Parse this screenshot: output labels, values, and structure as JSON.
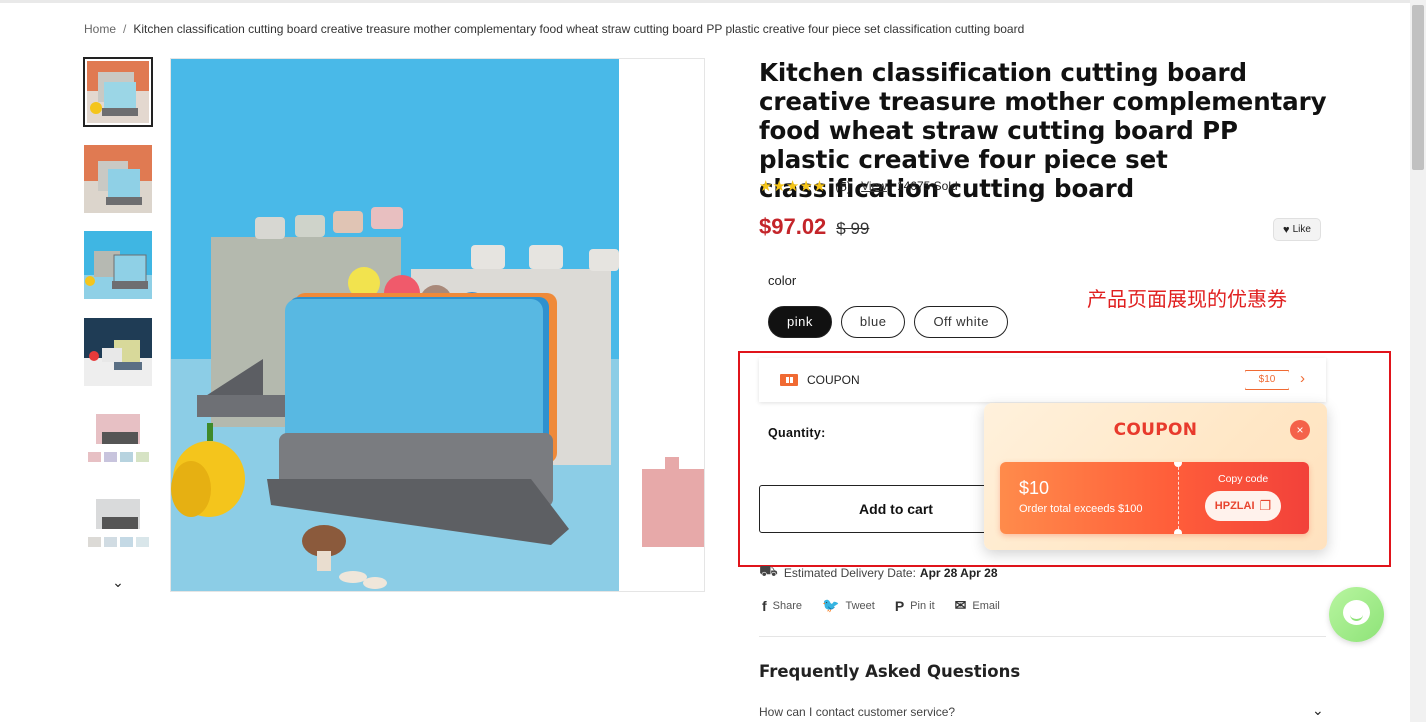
{
  "breadcrumb": {
    "home": "Home",
    "separator": "/",
    "current": "Kitchen classification cutting board creative treasure mother complementary food wheat straw cutting board PP plastic creative four piece set classification cutting board"
  },
  "product": {
    "title": "Kitchen classification cutting board creative treasure mother complementary food wheat straw cutting board PP plastic creative four piece set classification cutting board",
    "stars": "★★★★★",
    "review_count": "(5)",
    "view_label": "View",
    "sold": "14675 Sold",
    "price": "$97.02",
    "compare_price": "$ 99",
    "like_label": "Like",
    "color_label": "color",
    "colors": [
      "pink",
      "blue",
      "Off white"
    ],
    "selected_color": "pink",
    "quantity_label": "Quantity:",
    "add_to_cart": "Add to cart",
    "delivery_label": "Estimated Delivery Date:",
    "delivery_dates": "Apr 28 Apr 28"
  },
  "annotation": "产品页面展现的优惠券",
  "coupon_row": {
    "label": "COUPON",
    "tag": "$10",
    "chevron": "›"
  },
  "coupon_popup": {
    "title": "COUPON",
    "close": "×",
    "amount": "$10",
    "condition": "Order total exceeds $100",
    "copy_label": "Copy code",
    "code": "HPZLAI"
  },
  "share": {
    "share": "Share",
    "tweet": "Tweet",
    "pin": "Pin it",
    "email": "Email"
  },
  "faq": {
    "title": "Frequently Asked Questions",
    "first_question": "How can I contact customer service?"
  },
  "thumbnails": {
    "count_visible": 6,
    "more": "⌄"
  },
  "colors": {
    "price_red": "#c4252a",
    "coupon_orange": "#f06a33",
    "highlight_red": "#e0141b",
    "popup_title": "#e83a2c"
  }
}
